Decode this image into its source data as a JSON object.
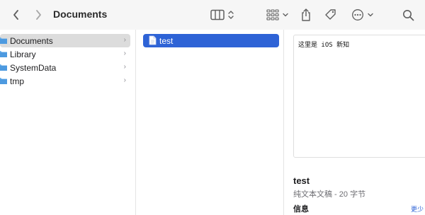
{
  "window": {
    "title": "Documents"
  },
  "toolbar": {
    "back_icon": "chevron-left-icon",
    "forward_icon": "chevron-right-icon",
    "view_icon": "column-view-icon",
    "group_icon": "grid-icon",
    "share_icon": "share-icon",
    "tag_icon": "tag-icon",
    "more_icon": "ellipsis-icon",
    "search_icon": "search-icon"
  },
  "sidebar_column": {
    "items": [
      {
        "label": "Documents",
        "chevron": "›",
        "selected": true
      },
      {
        "label": "Library",
        "chevron": "›",
        "selected": false
      },
      {
        "label": "SystemData",
        "chevron": "›",
        "selected": false
      },
      {
        "label": "tmp",
        "chevron": "›",
        "selected": false
      }
    ]
  },
  "file_column": {
    "items": [
      {
        "label": "test",
        "selected": true
      }
    ]
  },
  "preview": {
    "content": "这里是 iOS 新知",
    "file_name": "test",
    "file_kind": "纯文本文稿 - 20 字节",
    "info_label": "信息",
    "more_label": "更少"
  },
  "colors": {
    "toolbar_bg": "#f6f6f6",
    "selection_blue": "#2e63d6",
    "selection_gray": "#dcdcdc",
    "folder_blue": "#6aaee8"
  }
}
